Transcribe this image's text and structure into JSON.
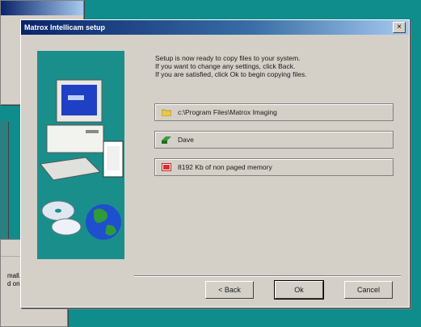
{
  "background_windows": {
    "bottom_left_lines": [
      "mall.",
      "d on your"
    ]
  },
  "dialog": {
    "title": "Matrox Intellicam setup",
    "message_lines": [
      "Setup is now ready to copy files to your system.",
      "If you want to change any settings, click Back.",
      "If you are satisfied, click Ok to begin copying files."
    ],
    "summary_items": [
      {
        "icon": "folder-icon",
        "text": "c:\\Program Files\\Matrox Imaging"
      },
      {
        "icon": "drive-icon",
        "text": "Dave"
      },
      {
        "icon": "memory-chip-icon",
        "text": "8192 Kb of non paged memory"
      }
    ],
    "buttons": {
      "back": "< Back",
      "ok": "Ok",
      "cancel": "Cancel"
    }
  },
  "colors": {
    "desktop": "#0f8c8c",
    "title_start": "#0a246a",
    "title_end": "#a6caf0",
    "side_panel": "#1a8e8a"
  }
}
